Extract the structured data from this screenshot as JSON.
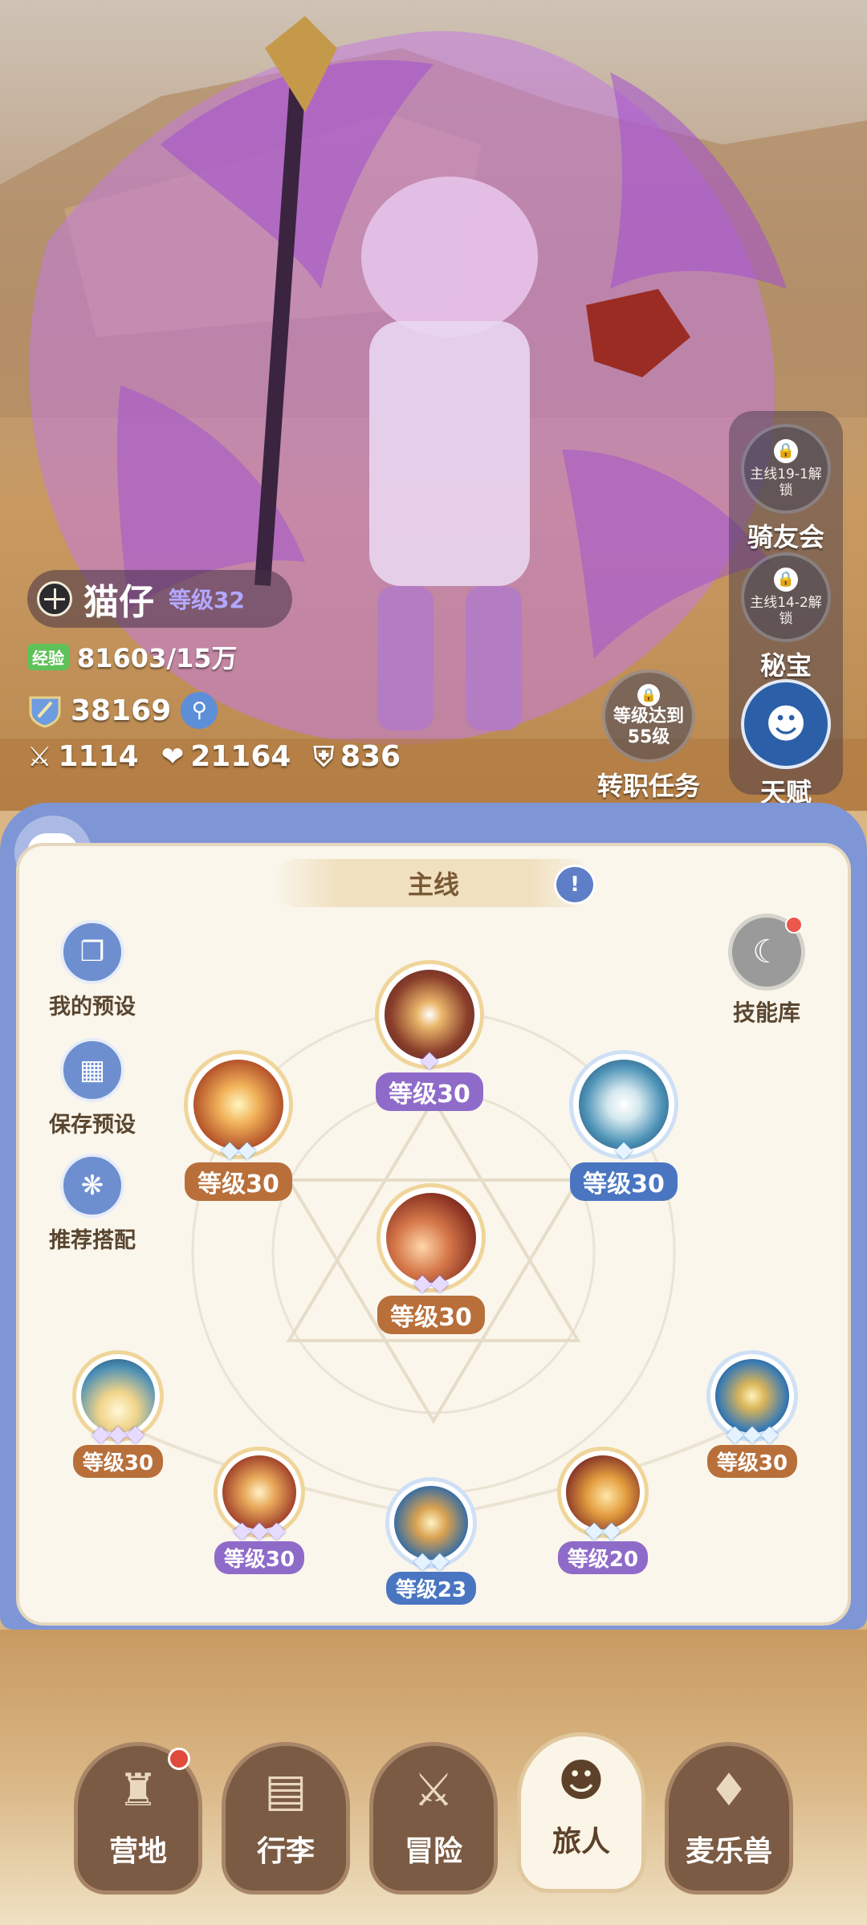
{
  "character": {
    "name": "猫仔",
    "level": "等级32",
    "exp_label": "经验",
    "exp_value": "81603/15万",
    "power": "38169",
    "attack": "1114",
    "hp": "21164",
    "defense": "836"
  },
  "side_buttons": {
    "rider_club": {
      "lock_text": "主线19-1解锁",
      "label": "骑友会"
    },
    "treasure": {
      "lock_text": "主线14-2解锁",
      "label": "秘宝"
    },
    "talent": {
      "label": "天赋"
    },
    "job_change": {
      "lock_text": "等级达到55级",
      "label": "转职任务"
    }
  },
  "panel": {
    "tab_label": "主线",
    "tools": [
      {
        "label": "我的预设"
      },
      {
        "label": "保存预设"
      },
      {
        "label": "推荐搭配"
      }
    ],
    "skill_library_label": "技能库",
    "skills": [
      {
        "level": "等级30",
        "stars": "◆",
        "color": "purple"
      },
      {
        "level": "等级30",
        "stars": "◆◆",
        "color": "brown"
      },
      {
        "level": "等级30",
        "stars": "◆",
        "color": "blue"
      },
      {
        "level": "等级30",
        "stars": "◆◆",
        "color": "brown"
      },
      {
        "level": "等级30",
        "stars": "◆◆◆",
        "color": "brown"
      },
      {
        "level": "等级30",
        "stars": "◆◆◆",
        "color": "purple"
      },
      {
        "level": "等级23",
        "stars": "◆◆",
        "color": "blue"
      },
      {
        "level": "等级20",
        "stars": "◆◆",
        "color": "purple"
      },
      {
        "level": "等级30",
        "stars": "◆◆◆",
        "color": "brown"
      }
    ]
  },
  "bottom_nav": [
    {
      "label": "营地",
      "icon": "castle-icon",
      "badge": true
    },
    {
      "label": "行李",
      "icon": "backpack-icon",
      "badge": false
    },
    {
      "label": "冒险",
      "icon": "crossed-swords-icon",
      "badge": false
    },
    {
      "label": "旅人",
      "icon": "traveler-icon",
      "badge": false,
      "active": true
    },
    {
      "label": "麦乐兽",
      "icon": "cat-icon",
      "badge": false
    }
  ],
  "colors": {
    "panel_frame": "#7e96d6",
    "panel_bg": "#faf6ec",
    "purple_level": "#8f6bc9",
    "brown_level": "#b86f3a",
    "blue_level": "#4a76c1"
  }
}
